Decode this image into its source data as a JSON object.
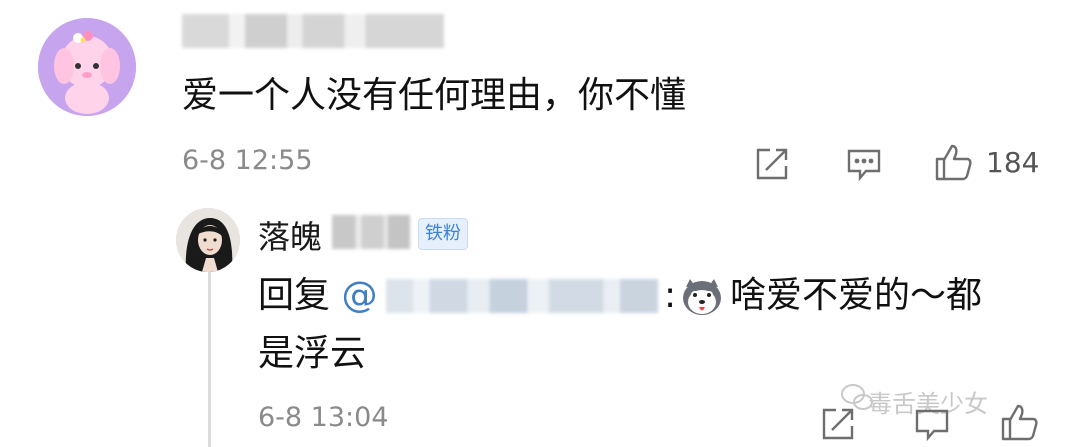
{
  "comment": {
    "username": "",
    "text": "爱一个人没有任何理由，你不懂",
    "time": "6-8 12:55",
    "likes": "184",
    "icons": [
      "share-icon",
      "reply-icon",
      "like-icon"
    ]
  },
  "reply": {
    "username_prefix": "落魄",
    "badge": "铁粉",
    "prefix": "回复 ",
    "mention_at": "@",
    "colon": ":",
    "text_line1": "啥爱不爱的～都",
    "text_line2": "是浮云",
    "time": "6-8 13:04",
    "icons": [
      "share-icon",
      "reply-icon",
      "like-icon"
    ]
  },
  "watermark": {
    "text": "毒舌美少女"
  },
  "colors": {
    "mention": "#3f7fc4",
    "badge_bg": "#e6f0fb",
    "badge_text": "#3c82d8",
    "meta_gray": "#8a8a8a"
  }
}
